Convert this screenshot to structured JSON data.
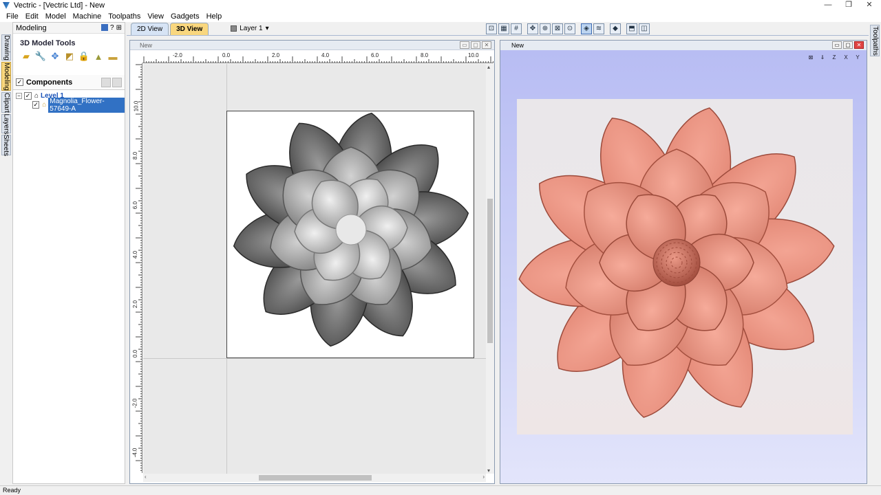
{
  "window": {
    "title": "Vectric - [Vectric Ltd] - New"
  },
  "menu": [
    "File",
    "Edit",
    "Model",
    "Machine",
    "Toolpaths",
    "View",
    "Gadgets",
    "Help"
  ],
  "left_tabs": [
    "Drawing",
    "Modeling",
    "Clipart",
    "Layers",
    "Sheets"
  ],
  "right_tabs": [
    "Toolpaths"
  ],
  "panel": {
    "title": "Modeling",
    "help": "?",
    "section_title": "3D Model Tools",
    "components_title": "Components",
    "tree": {
      "level_label": "Level 1",
      "component_label": "Magnolia_Flower-57649-A"
    }
  },
  "view_tabs": {
    "tab_2d": "2D View",
    "tab_3d": "3D View"
  },
  "layer_selector": {
    "label": "Layer 1",
    "arrow": "▾"
  },
  "window_2d": {
    "title": "New",
    "h_ruler": [
      "-2.0",
      "0.0",
      "2.0",
      "4.0",
      "6.0",
      "8.0",
      "10.0"
    ],
    "v_ruler": [
      "10.0",
      "8.0",
      "6.0",
      "4.0",
      "2.0",
      "0.0",
      "-2.0",
      "-4.0"
    ]
  },
  "window_3d": {
    "title": "New",
    "orient_icons": [
      "fit-icon",
      "iso-icon",
      "z-axis-icon",
      "x-axis-icon",
      "y-axis-icon"
    ],
    "orient_labels": [
      "⊠",
      "⇓",
      "Z",
      "X",
      "Y"
    ]
  },
  "toolbar_icons": [
    "zoom-fit-icon",
    "grid-snap-icon",
    "grid-icon",
    "pan-icon",
    "zoom-in-icon",
    "zoom-box-icon",
    "zoom-icon",
    "render-icon",
    "shade-icon",
    "material-icon",
    "split-h-icon",
    "split-v-icon"
  ],
  "status": {
    "text": "Ready"
  },
  "colors": {
    "relief": "#e8907e",
    "relief_shadow": "#b45a4a",
    "background_3d": "#b7bcf3",
    "active_tab": "#f9d77e"
  }
}
